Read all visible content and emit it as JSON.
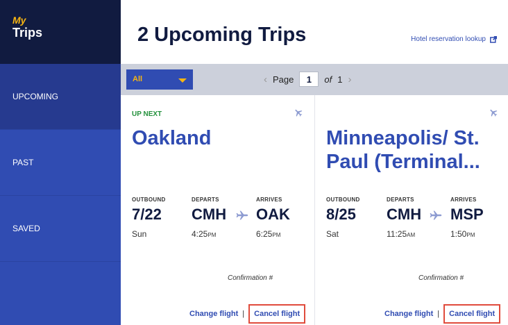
{
  "sidebar": {
    "my": "My",
    "trips": "Trips",
    "items": [
      {
        "label": "UPCOMING",
        "active": true
      },
      {
        "label": "PAST",
        "active": false
      },
      {
        "label": "SAVED",
        "active": false
      }
    ]
  },
  "header": {
    "title": "2 Upcoming Trips",
    "hotel_link": "Hotel reservation lookup",
    "hotel_icon": "external-link-icon"
  },
  "toolbar": {
    "filter_value": "All",
    "page_label": "Page",
    "page_current": "1",
    "page_of": "of",
    "page_total": "1"
  },
  "trips": [
    {
      "badge": "UP NEXT",
      "city": "Oakland",
      "labels": {
        "outbound": "OUTBOUND",
        "departs": "DEPARTS",
        "arrives": "ARRIVES"
      },
      "date": "7/22",
      "day": "Sun",
      "from": "CMH",
      "to": "OAK",
      "depart_time": "4:25",
      "depart_ampm": "PM",
      "arrive_time": "6:25",
      "arrive_ampm": "PM",
      "confirmation_label": "Confirmation #",
      "change_label": "Change flight",
      "separator": "|",
      "cancel_label": "Cancel flight"
    },
    {
      "badge": "",
      "city": "Minneapolis/ St. Paul (Terminal...",
      "labels": {
        "outbound": "OUTBOUND",
        "departs": "DEPARTS",
        "arrives": "ARRIVES"
      },
      "date": "8/25",
      "day": "Sat",
      "from": "CMH",
      "to": "MSP",
      "depart_time": "11:25",
      "depart_ampm": "AM",
      "arrive_time": "1:50",
      "arrive_ampm": "PM",
      "confirmation_label": "Confirmation #",
      "change_label": "Change flight",
      "separator": "|",
      "cancel_label": "Cancel flight"
    }
  ],
  "colors": {
    "brand_blue": "#304cb2",
    "navy": "#111b40",
    "accent_yellow": "#f9b612",
    "up_next_green": "#24913c",
    "highlight_red": "#e04b3c"
  }
}
